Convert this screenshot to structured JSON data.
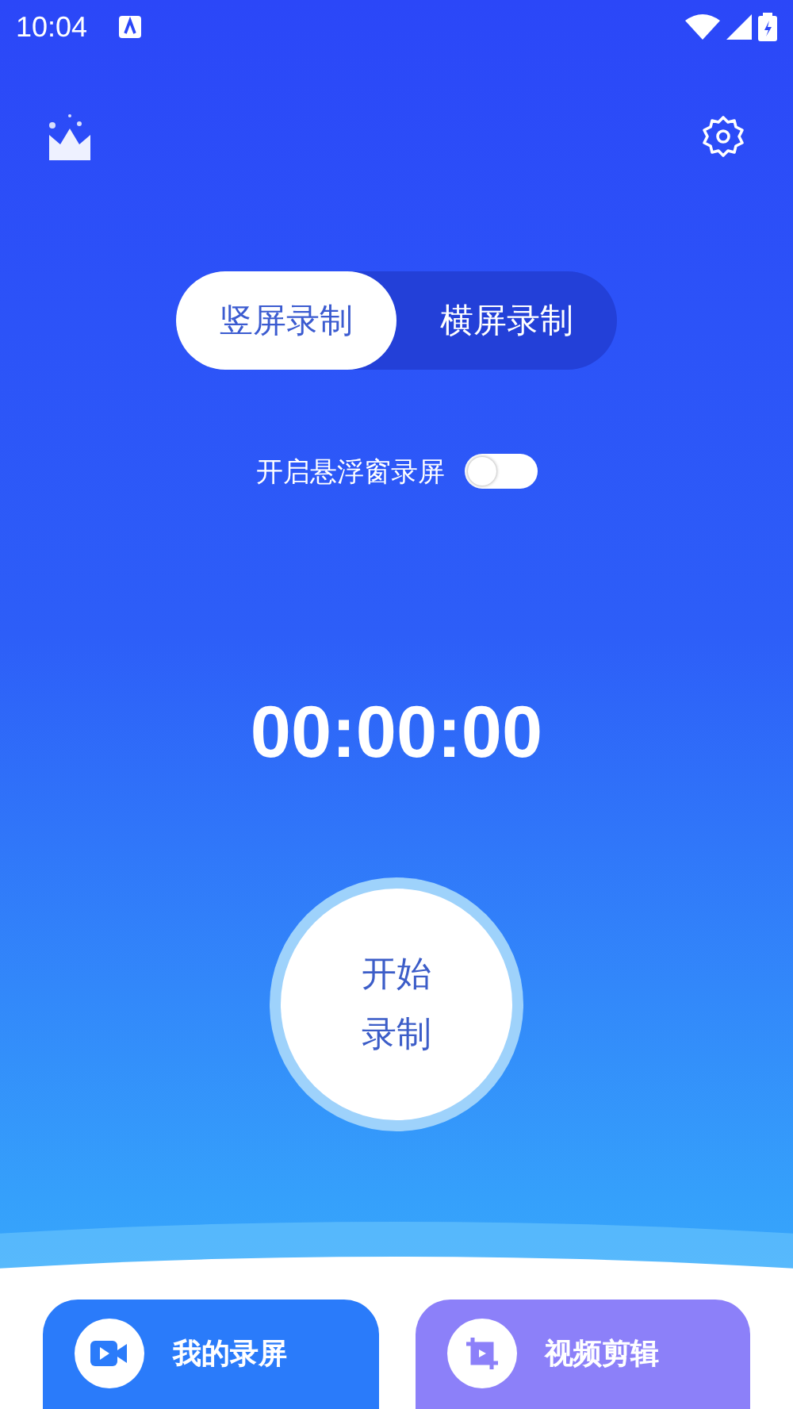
{
  "status_bar": {
    "time": "10:04"
  },
  "mode_tabs": [
    {
      "label": "竖屏录制",
      "selected": true
    },
    {
      "label": "横屏录制",
      "selected": false
    }
  ],
  "floating_window": {
    "label": "开启悬浮窗录屏",
    "on": false
  },
  "timer": "00:00:00",
  "record_button": {
    "label": "开始录制"
  },
  "cards": [
    {
      "kind": "recordings",
      "label": "我的录屏",
      "color": "#2a7bfa"
    },
    {
      "kind": "edit",
      "label": "视频剪辑",
      "color": "#8c80f9"
    }
  ]
}
